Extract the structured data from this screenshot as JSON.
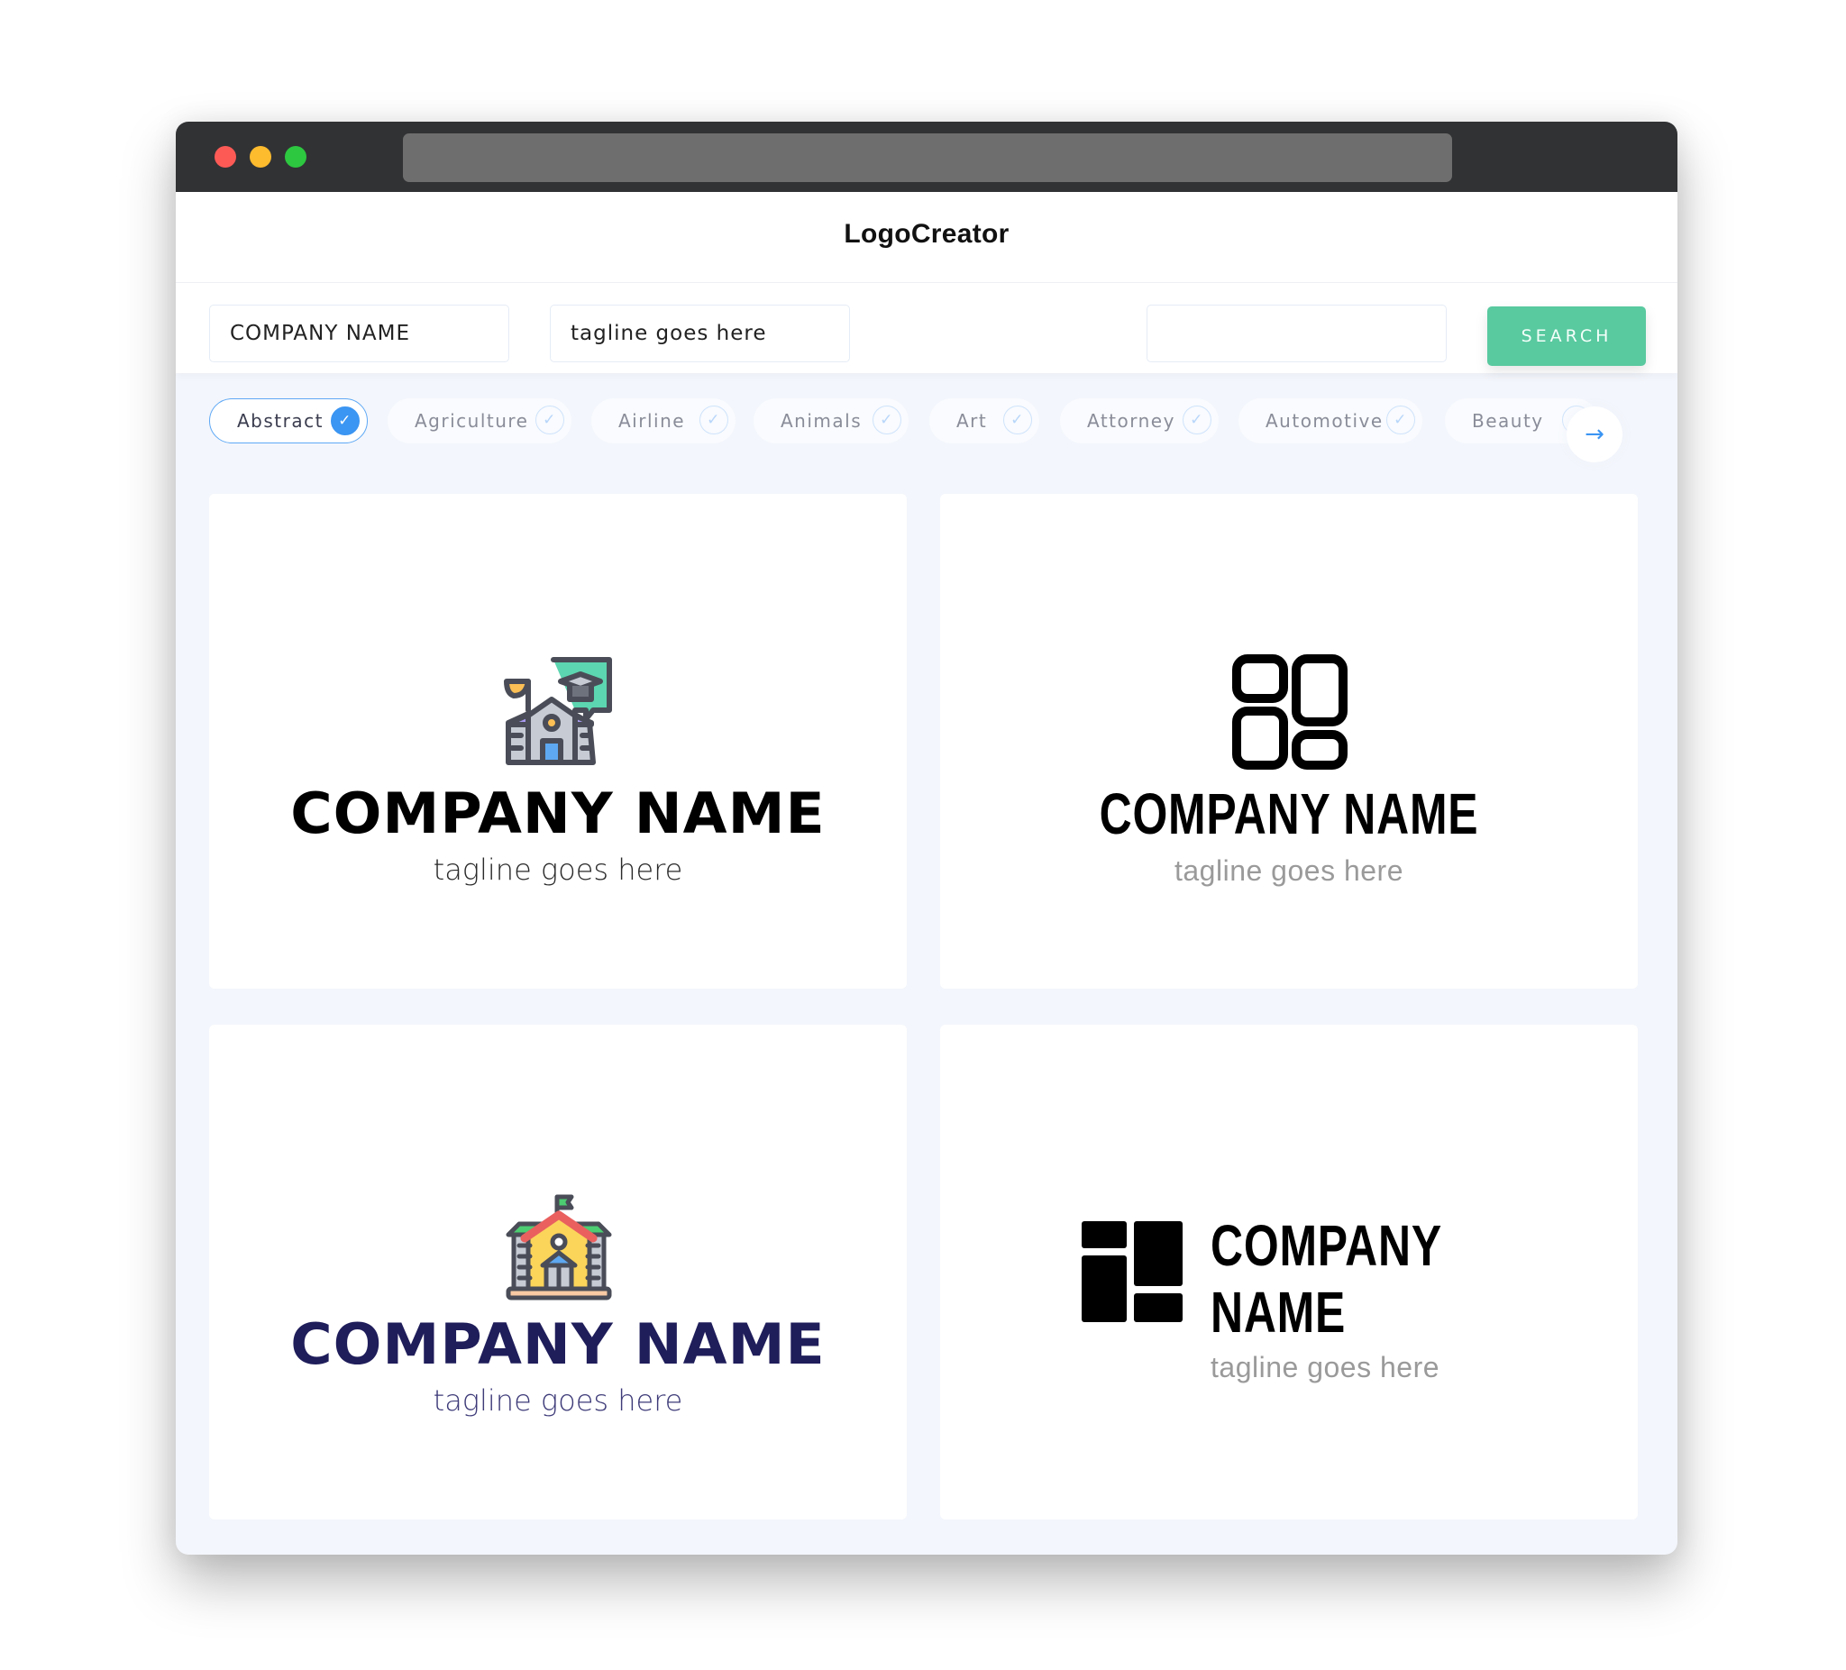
{
  "window": {
    "controls": [
      "close",
      "minimize",
      "maximize"
    ],
    "colors": {
      "close": "#fd5a56",
      "minimize": "#fdbb2e",
      "maximize": "#2dc740"
    }
  },
  "header": {
    "title": "LogoCreator"
  },
  "toolbar": {
    "company_value": "COMPANY NAME",
    "tagline_value": "tagline goes here",
    "search_value": "",
    "search_label": "SEARCH",
    "accent": "#59c9a0"
  },
  "categories": [
    {
      "label": "Abstract",
      "selected": true
    },
    {
      "label": "Agriculture",
      "selected": false
    },
    {
      "label": "Airline",
      "selected": false
    },
    {
      "label": "Animals",
      "selected": false
    },
    {
      "label": "Art",
      "selected": false
    },
    {
      "label": "Attorney",
      "selected": false
    },
    {
      "label": "Automotive",
      "selected": false
    },
    {
      "label": "Beauty",
      "selected": false
    }
  ],
  "next_icon": "arrow-right-icon",
  "logos": [
    {
      "icon": "school-graduation-chat-icon",
      "name": "COMPANY NAME",
      "tagline": "tagline goes here"
    },
    {
      "icon": "grid-layout-outline-icon",
      "name": "COMPANY NAME",
      "tagline": "tagline goes here"
    },
    {
      "icon": "school-building-icon",
      "name": "COMPANY NAME",
      "tagline": "tagline goes here"
    },
    {
      "icon": "grid-layout-solid-icon",
      "name": "COMPANY NAME",
      "tagline": "tagline goes here"
    }
  ]
}
